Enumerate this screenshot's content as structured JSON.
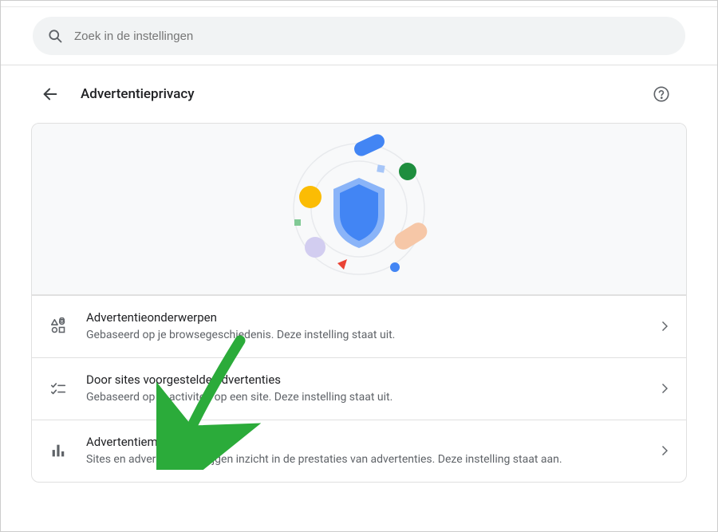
{
  "search": {
    "placeholder": "Zoek in de instellingen"
  },
  "header": {
    "title": "Advertentieprivacy"
  },
  "settings": [
    {
      "title": "Advertentieonderwerpen",
      "subtitle": "Gebaseerd op je browsegeschiedenis. Deze instelling staat uit."
    },
    {
      "title": "Door sites voorgestelde advertenties",
      "subtitle": "Gebaseerd op je activiteit op een site. Deze instelling staat uit."
    },
    {
      "title": "Advertentiemeting",
      "subtitle": "Sites en adverteerders krijgen inzicht in de prestaties van advertenties. Deze instelling staat aan."
    }
  ]
}
